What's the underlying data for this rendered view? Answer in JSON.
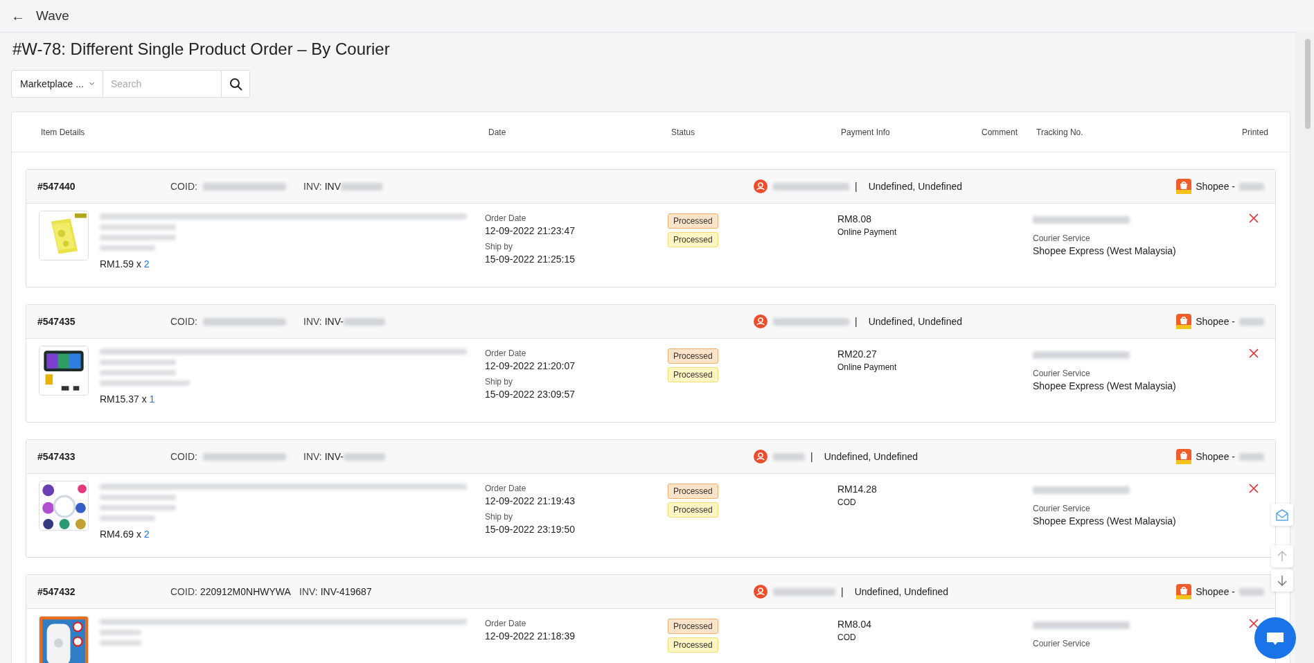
{
  "topbar": {
    "back": "←",
    "title": "Wave"
  },
  "page_title": "#W-78: Different Single Product Order – By Courier",
  "filter": {
    "dropdown": "Marketplace ...",
    "search_placeholder": "Search"
  },
  "table": {
    "columns": [
      "Item Details",
      "Date",
      "Status",
      "Payment Info",
      "Comment",
      "Tracking No.",
      "Printed"
    ],
    "orders": [
      {
        "id": "#547440",
        "coid_label": "COID:",
        "inv_label": "INV:",
        "inv": "INV",
        "separator": "|",
        "undefined": "Undefined, Undefined",
        "channel": "Shopee - ",
        "price": "RM1.59 x ",
        "qty": "2",
        "order_date_label": "Order Date",
        "order_date": "12-09-2022 21:23:47",
        "ship_label": "Ship by",
        "ship_by": "15-09-2022 21:25:15",
        "statuses": [
          {
            "label": "Processed",
            "kind": "primary"
          },
          {
            "label": "Processed",
            "kind": "secondary"
          }
        ],
        "amount": "RM8.08",
        "method": "Online Payment",
        "courier_label": "Courier Service",
        "courier": "Shopee Express (West Malaysia)",
        "printed": false
      },
      {
        "id": "#547435",
        "coid_label": "COID:",
        "inv_label": "INV:",
        "inv": "INV-",
        "separator": "|",
        "undefined": "Undefined, Undefined",
        "channel": "Shopee - ",
        "price": "RM15.37 x ",
        "qty": "1",
        "order_date_label": "Order Date",
        "order_date": "12-09-2022 21:20:07",
        "ship_label": "Ship by",
        "ship_by": "15-09-2022 23:09:57",
        "statuses": [
          {
            "label": "Processed",
            "kind": "primary"
          },
          {
            "label": "Processed",
            "kind": "secondary"
          }
        ],
        "amount": "RM20.27",
        "method": "Online Payment",
        "courier_label": "Courier Service",
        "courier": "Shopee Express (West Malaysia)",
        "printed": false
      },
      {
        "id": "#547433",
        "coid_label": "COID:",
        "inv_label": "INV:",
        "inv": "INV-",
        "separator": "|",
        "undefined": "Undefined, Undefined",
        "channel": "Shopee - ",
        "price": "RM4.69 x ",
        "qty": "2",
        "order_date_label": "Order Date",
        "order_date": "12-09-2022 21:19:43",
        "ship_label": "Ship by",
        "ship_by": "15-09-2022 23:19:50",
        "statuses": [
          {
            "label": "Processed",
            "kind": "primary"
          },
          {
            "label": "Processed",
            "kind": "secondary"
          }
        ],
        "amount": "RM14.28",
        "method": "COD",
        "courier_label": "Courier Service",
        "courier": "Shopee Express (West Malaysia)",
        "printed": false
      },
      {
        "id": "#547432",
        "coid_label": "COID:",
        "coid": "220912M0NHWYWA",
        "inv_label": "INV:",
        "inv": "INV-419687",
        "separator": "|",
        "undefined": "Undefined, Undefined",
        "channel": "Shopee - ",
        "order_date_label": "Order Date",
        "order_date": "12-09-2022 21:18:39",
        "statuses": [
          {
            "label": "Processed",
            "kind": "primary"
          },
          {
            "label": "Processed",
            "kind": "secondary"
          }
        ],
        "amount": "RM8.04",
        "method": "COD",
        "courier_label": "Courier Service",
        "printed": false
      }
    ]
  }
}
